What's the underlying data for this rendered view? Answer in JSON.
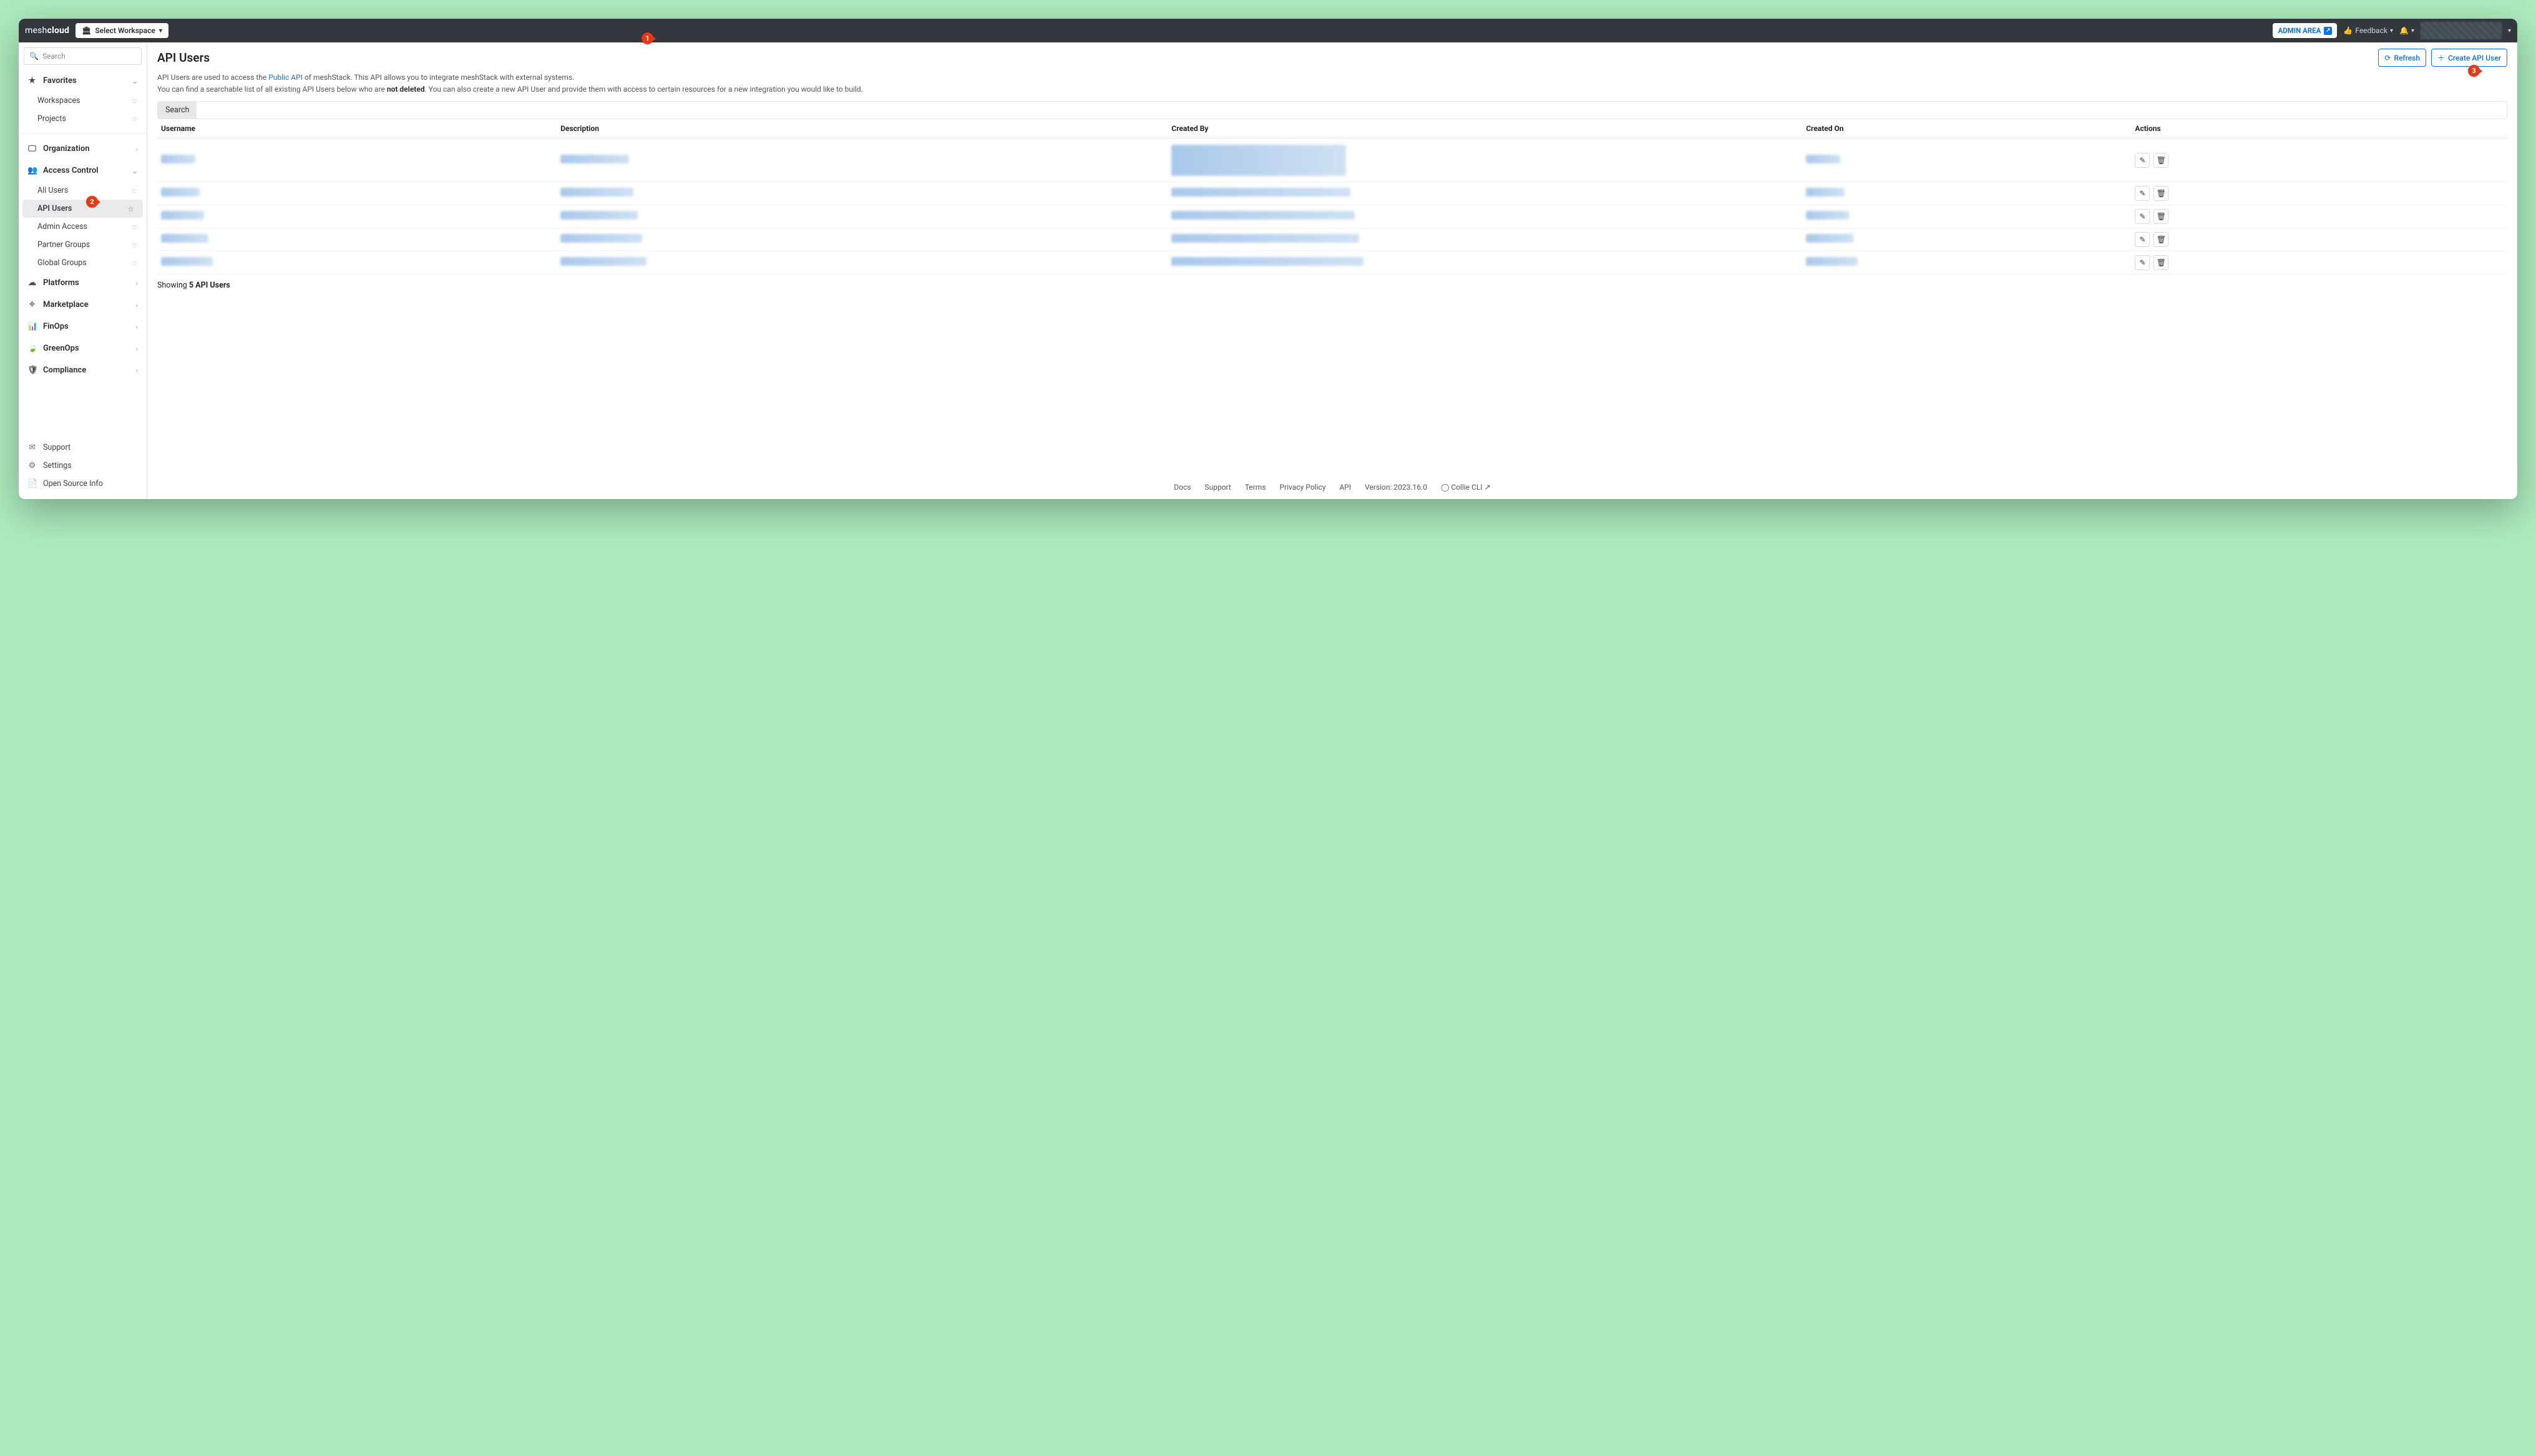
{
  "brand": {
    "left": "mesh",
    "right": "cloud"
  },
  "topbar": {
    "workspace_label": "Select Workspace",
    "admin_area_label": "ADMIN AREA",
    "feedback_label": "Feedback"
  },
  "search": {
    "placeholder": "Search"
  },
  "sidebar": {
    "favorites_label": "Favorites",
    "favorites_children": [
      "Workspaces",
      "Projects"
    ],
    "groups": [
      {
        "label": "Organization",
        "icon": "▭"
      },
      {
        "label": "Access Control",
        "icon": "👥",
        "expanded": true,
        "children": [
          "All Users",
          "API Users",
          "Admin Access",
          "Partner Groups",
          "Global Groups"
        ],
        "active_child": "API Users"
      },
      {
        "label": "Platforms",
        "icon": "☁"
      },
      {
        "label": "Marketplace",
        "icon": "✦"
      },
      {
        "label": "FinOps",
        "icon": "📊"
      },
      {
        "label": "GreenOps",
        "icon": "🍃"
      },
      {
        "label": "Compliance",
        "icon": "🛡"
      }
    ],
    "footer": [
      {
        "label": "Support",
        "icon": "✉"
      },
      {
        "label": "Settings",
        "icon": "⚙"
      },
      {
        "label": "Open Source Info",
        "icon": "📄"
      }
    ]
  },
  "page": {
    "title": "API Users",
    "refresh_label": "Refresh",
    "create_label": "Create API User",
    "intro_parts": {
      "p1a": "API Users are used to access the ",
      "public_api": "Public API",
      "p1b": " of meshStack. This API allows you to integrate meshStack with external systems.",
      "p2a": "You can find a searchable list of all existing API Users below who are ",
      "not_deleted": "not deleted",
      "p2b": ". You can also create a new API User and provide them with access to certain resources for a new integration you would like to build."
    },
    "search_tab_label": "Search"
  },
  "table": {
    "columns": [
      "Username",
      "Description",
      "Created By",
      "Created On",
      "Actions"
    ],
    "row_count": 5,
    "showing_prefix": "Showing ",
    "showing_count": "5 API Users"
  },
  "footer_links": [
    "Docs",
    "Support",
    "Terms",
    "Privacy Policy",
    "API"
  ],
  "footer_version": "Version: 2023.16.0",
  "footer_cli": "Collie CLI",
  "annotations": {
    "1": "1",
    "2": "2",
    "3": "3"
  }
}
